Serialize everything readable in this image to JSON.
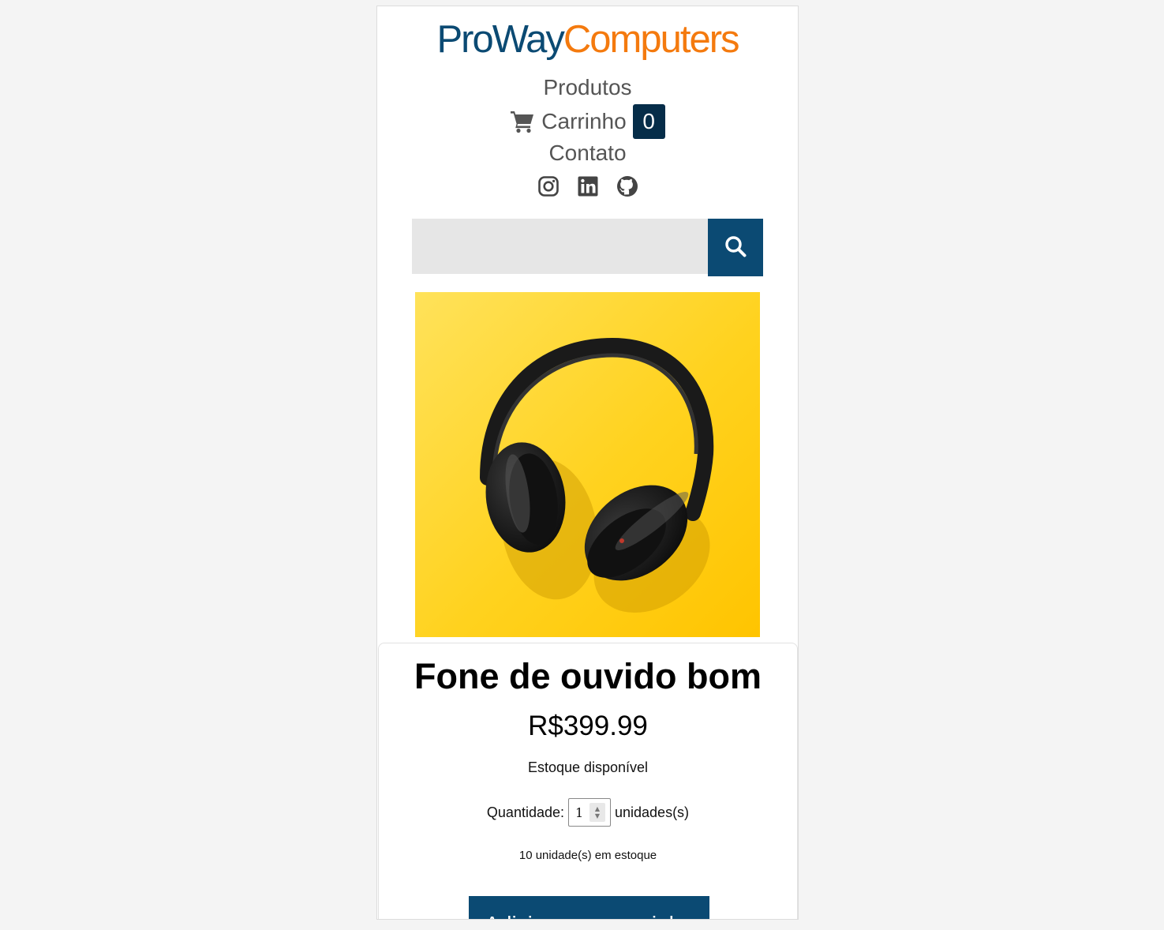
{
  "header": {
    "logo_part1": "ProWay",
    "logo_part2": "Computers",
    "brand_blue": "#0b4a73",
    "brand_orange": "#f47a0e"
  },
  "nav": {
    "products": "Produtos",
    "cart_label": "Carrinho",
    "cart_count": "0",
    "contact": "Contato"
  },
  "socials": [
    "instagram-icon",
    "linkedin-icon",
    "github-icon"
  ],
  "search": {
    "placeholder": "",
    "value": ""
  },
  "product": {
    "image_alt": "Fone de ouvido bom",
    "title": "Fone de ouvido bom",
    "price": "R$399.99",
    "stock_status": "Estoque disponível",
    "quantity_label": "Quantidade:",
    "quantity_value": "1",
    "quantity_unit": "unidades(s)",
    "in_stock_text": "10 unidade(s) em estoque",
    "add_button": "Adicionar ao carrinho"
  }
}
